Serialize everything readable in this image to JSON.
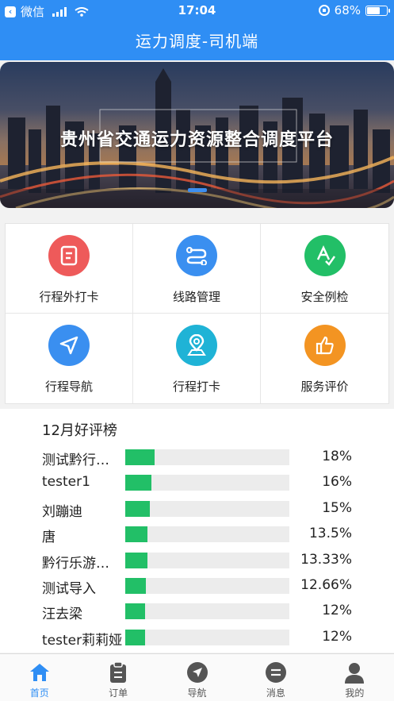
{
  "status_bar": {
    "carrier": "微信",
    "time": "17:04",
    "battery": "68%",
    "battery_level": 0.68
  },
  "header": {
    "title": "运力调度-司机端"
  },
  "banner": {
    "text": "贵州省交通运力资源整合调度平台"
  },
  "menu": [
    {
      "label": "行程外打卡",
      "icon": "document-icon",
      "color": "#ee5a5a"
    },
    {
      "label": "线路管理",
      "icon": "route-icon",
      "color": "#3a8ff0"
    },
    {
      "label": "安全例检",
      "icon": "safety-check-icon",
      "color": "#22bf67"
    },
    {
      "label": "行程导航",
      "icon": "navigation-icon",
      "color": "#3a8ff0"
    },
    {
      "label": "行程打卡",
      "icon": "location-pin-icon",
      "color": "#1fb3d6"
    },
    {
      "label": "服务评价",
      "icon": "thumbs-up-icon",
      "color": "#f39422"
    }
  ],
  "ranking": {
    "title": "12月好评榜",
    "bar_color": "#22bf67",
    "items": [
      {
        "name": "测试黔行…",
        "percent": "18%",
        "value": 0.18
      },
      {
        "name": "tester1",
        "percent": "16%",
        "value": 0.16
      },
      {
        "name": "刘蹦迪",
        "percent": "15%",
        "value": 0.15
      },
      {
        "name": "唐",
        "percent": "13.5%",
        "value": 0.135
      },
      {
        "name": "黔行乐游…",
        "percent": "13.33%",
        "value": 0.1333
      },
      {
        "name": "测试导入",
        "percent": "12.66%",
        "value": 0.1266
      },
      {
        "name": "汪去梁",
        "percent": "12%",
        "value": 0.12
      },
      {
        "name": "tester莉莉娅",
        "percent": "12%",
        "value": 0.12
      }
    ]
  },
  "tabs": [
    {
      "label": "首页",
      "icon": "home-icon",
      "active": true
    },
    {
      "label": "订单",
      "icon": "clipboard-icon",
      "active": false
    },
    {
      "label": "导航",
      "icon": "compass-icon",
      "active": false
    },
    {
      "label": "消息",
      "icon": "message-icon",
      "active": false
    },
    {
      "label": "我的",
      "icon": "user-icon",
      "active": false
    }
  ],
  "colors": {
    "primary": "#2f8ef4",
    "active_tab": "#2f8ef4"
  }
}
